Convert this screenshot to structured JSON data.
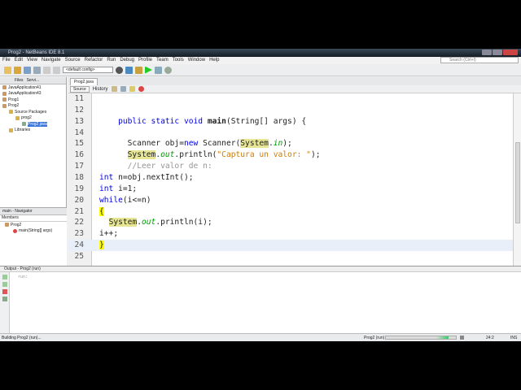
{
  "window": {
    "title": "Prog2 - NetBeans IDE 8.1"
  },
  "menu": [
    "File",
    "Edit",
    "View",
    "Navigate",
    "Source",
    "Refactor",
    "Run",
    "Debug",
    "Profile",
    "Team",
    "Tools",
    "Window",
    "Help"
  ],
  "search": {
    "placeholder": "Search (Ctrl+I)"
  },
  "toolbar": {
    "config": "<default config>"
  },
  "projects": {
    "tabs": [
      "Files",
      "Servi..."
    ],
    "items": [
      {
        "label": "JavaApplication41",
        "depth": 0
      },
      {
        "label": "JavaApplication43",
        "depth": 0
      },
      {
        "label": "Prog1",
        "depth": 0
      },
      {
        "label": "Prog2",
        "depth": 0
      },
      {
        "label": "Source Packages",
        "depth": 1
      },
      {
        "label": "prog2",
        "depth": 2
      },
      {
        "label": "Prog2.java",
        "depth": 3,
        "selected": true
      },
      {
        "label": "Libraries",
        "depth": 1
      }
    ]
  },
  "navigator": {
    "title": "main - Navigator",
    "filter": "Members",
    "items": [
      "Prog2",
      "main(String[] args)"
    ]
  },
  "editor": {
    "tab": "Prog2.java",
    "source_label": "Source",
    "history_label": "History",
    "lines": [
      {
        "n": "11",
        "t": []
      },
      {
        "n": "12",
        "t": []
      },
      {
        "n": "13",
        "t": [
          [
            "    ",
            ""
          ],
          [
            "public static void ",
            "kw"
          ],
          [
            "main",
            "bd"
          ],
          [
            "(String[] args) {",
            ""
          ]
        ]
      },
      {
        "n": "14",
        "t": []
      },
      {
        "n": "15",
        "t": [
          [
            "      Scanner obj=",
            ""
          ],
          [
            "new",
            "kw"
          ],
          [
            " Scanner(",
            ""
          ],
          [
            "System",
            "hl"
          ],
          [
            ".",
            ""
          ],
          [
            "in",
            "fld"
          ],
          [
            ");",
            ""
          ]
        ]
      },
      {
        "n": "16",
        "t": [
          [
            "      ",
            ""
          ],
          [
            "System",
            "hl"
          ],
          [
            ".",
            ""
          ],
          [
            "out",
            "fld"
          ],
          [
            ".println(",
            ""
          ],
          [
            "\"Captura un valor: \"",
            "str"
          ],
          [
            ");",
            ""
          ]
        ]
      },
      {
        "n": "17",
        "t": [
          [
            "      ",
            ""
          ],
          [
            "//Leer valor de n:",
            "cm"
          ]
        ]
      },
      {
        "n": "18",
        "t": [
          [
            "int",
            "kw"
          ],
          [
            " n=obj.nextInt();",
            ""
          ]
        ]
      },
      {
        "n": "19",
        "t": [
          [
            "int",
            "kw"
          ],
          [
            " i=1;",
            ""
          ]
        ]
      },
      {
        "n": "20",
        "t": [
          [
            "while",
            "kw"
          ],
          [
            "(i<=n)",
            ""
          ]
        ]
      },
      {
        "n": "21",
        "t": [
          [
            "{",
            "br"
          ]
        ]
      },
      {
        "n": "22",
        "t": [
          [
            "  ",
            ""
          ],
          [
            "System",
            "hl"
          ],
          [
            ".",
            ""
          ],
          [
            "out",
            "fld"
          ],
          [
            ".println(i);",
            ""
          ]
        ]
      },
      {
        "n": "23",
        "t": [
          [
            "i++;",
            ""
          ]
        ]
      },
      {
        "n": "24",
        "t": [
          [
            "}",
            "br"
          ]
        ],
        "current": true
      },
      {
        "n": "25",
        "t": []
      }
    ]
  },
  "output": {
    "title": "Output - Prog2 (run)",
    "text": "run:"
  },
  "status": {
    "task": "Building Prog2 (run)...",
    "progress_label": "Prog2 (run)",
    "progress": 0.9,
    "position": "24:2",
    "mode": "INS"
  }
}
